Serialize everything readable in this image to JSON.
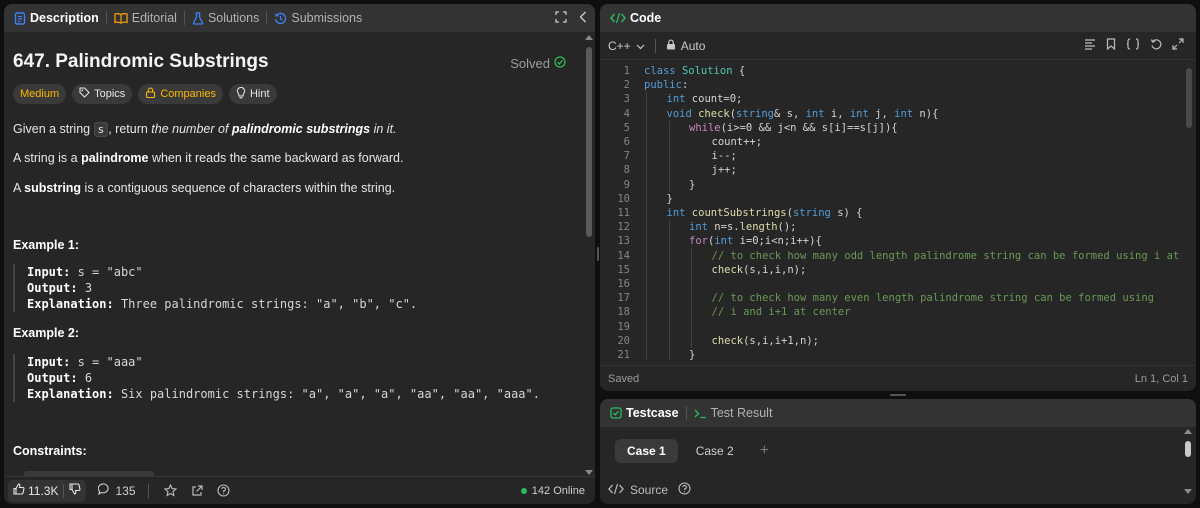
{
  "left_tabs": [
    {
      "label": "Description",
      "icon": "document-icon",
      "color": "#3b82f6"
    },
    {
      "label": "Editorial",
      "icon": "book-icon",
      "color": "#f59e0b"
    },
    {
      "label": "Solutions",
      "icon": "flask-icon",
      "color": "#3b82f6"
    },
    {
      "label": "Submissions",
      "icon": "history-icon",
      "color": "#3b82f6"
    }
  ],
  "problem": {
    "title": "647. Palindromic Substrings",
    "status": "Solved",
    "tags": {
      "difficulty": "Medium",
      "topics": "Topics",
      "companies": "Companies",
      "hint": "Hint"
    },
    "para1": {
      "pre": "Given a string ",
      "code": "s",
      "mid": ", return ",
      "italic_pre": "the number of ",
      "bold_italic": "palindromic substrings",
      "italic_post": " in it."
    },
    "para2": {
      "pre": "A string is a ",
      "bold": "palindrome",
      "post": " when it reads the same backward as forward."
    },
    "para3": {
      "pre": "A ",
      "bold": "substring",
      "post": " is a contiguous sequence of characters within the string."
    },
    "examples": [
      {
        "title": "Example 1:",
        "input_label": "Input:",
        "input": "s = \"abc\"",
        "output_label": "Output:",
        "output": "3",
        "explanation_label": "Explanation:",
        "explanation": "Three palindromic strings: \"a\", \"b\", \"c\"."
      },
      {
        "title": "Example 2:",
        "input_label": "Input:",
        "input": "s = \"aaa\"",
        "output_label": "Output:",
        "output": "6",
        "explanation_label": "Explanation:",
        "explanation": "Six palindromic strings: \"a\", \"a\", \"a\", \"aa\", \"aa\", \"aaa\"."
      }
    ],
    "constraints_title": "Constraints:"
  },
  "left_footer": {
    "likes": "11.3K",
    "comments": "135",
    "online": "142 Online"
  },
  "code_panel": {
    "title": "Code",
    "language": "C++",
    "mode": "Auto",
    "status": "Saved",
    "cursor": "Ln 1, Col 1",
    "lines": [
      {
        "n": "1",
        "indent": 0,
        "parts": [
          [
            "kw",
            "class "
          ],
          [
            "cls",
            "Solution "
          ],
          [
            "",
            "{"
          ]
        ]
      },
      {
        "n": "2",
        "indent": 0,
        "parts": [
          [
            "kw",
            "public"
          ],
          [
            "",
            ":"
          ]
        ]
      },
      {
        "n": "3",
        "indent": 1,
        "parts": [
          [
            "kw",
            "int "
          ],
          [
            "",
            "count=0;"
          ]
        ]
      },
      {
        "n": "4",
        "indent": 1,
        "parts": [
          [
            "kw",
            "void "
          ],
          [
            "fn",
            "check"
          ],
          [
            "",
            "("
          ],
          [
            "kw",
            "string"
          ],
          [
            "",
            "& s, "
          ],
          [
            "kw",
            "int "
          ],
          [
            "",
            "i, "
          ],
          [
            "kw",
            "int "
          ],
          [
            "",
            "j, "
          ],
          [
            "kw",
            "int "
          ],
          [
            "",
            "n){"
          ]
        ]
      },
      {
        "n": "5",
        "indent": 2,
        "parts": [
          [
            "ctl",
            "while"
          ],
          [
            "",
            "(i>=0 && j<n && s[i]==s[j]){"
          ]
        ]
      },
      {
        "n": "6",
        "indent": 3,
        "parts": [
          [
            "",
            "count++;"
          ]
        ]
      },
      {
        "n": "7",
        "indent": 3,
        "parts": [
          [
            "",
            "i--;"
          ]
        ]
      },
      {
        "n": "8",
        "indent": 3,
        "parts": [
          [
            "",
            "j++;"
          ]
        ]
      },
      {
        "n": "9",
        "indent": 2,
        "parts": [
          [
            "",
            "}"
          ]
        ]
      },
      {
        "n": "10",
        "indent": 1,
        "parts": [
          [
            "",
            "}"
          ]
        ]
      },
      {
        "n": "11",
        "indent": 1,
        "parts": [
          [
            "kw",
            "int "
          ],
          [
            "fn",
            "countSubstrings"
          ],
          [
            "",
            "("
          ],
          [
            "kw",
            "string "
          ],
          [
            "",
            "s) {"
          ]
        ]
      },
      {
        "n": "12",
        "indent": 2,
        "parts": [
          [
            "kw",
            "int "
          ],
          [
            "",
            "n=s."
          ],
          [
            "fn",
            "length"
          ],
          [
            "",
            "();"
          ]
        ]
      },
      {
        "n": "13",
        "indent": 2,
        "parts": [
          [
            "ctl",
            "for"
          ],
          [
            "",
            "("
          ],
          [
            "kw",
            "int "
          ],
          [
            "",
            "i=0;i<n;i++){"
          ]
        ]
      },
      {
        "n": "14",
        "indent": 3,
        "parts": [
          [
            "cm",
            "// to check how many odd length palindrome string can be formed using i at center"
          ]
        ]
      },
      {
        "n": "15",
        "indent": 3,
        "parts": [
          [
            "fn",
            "check"
          ],
          [
            "",
            "(s,i,i,n);"
          ]
        ]
      },
      {
        "n": "16",
        "indent": 0,
        "parts": []
      },
      {
        "n": "17",
        "indent": 3,
        "parts": [
          [
            "cm",
            "// to check how many even length palindrome string can be formed using"
          ]
        ]
      },
      {
        "n": "18",
        "indent": 3,
        "parts": [
          [
            "cm",
            "// i and i+1 at center"
          ]
        ]
      },
      {
        "n": "19",
        "indent": 0,
        "parts": []
      },
      {
        "n": "20",
        "indent": 3,
        "parts": [
          [
            "fn",
            "check"
          ],
          [
            "",
            "(s,i,i+1,n);"
          ]
        ]
      },
      {
        "n": "21",
        "indent": 2,
        "parts": [
          [
            "",
            "}"
          ]
        ]
      }
    ]
  },
  "test_panel": {
    "tab_testcase": "Testcase",
    "tab_result": "Test Result",
    "cases": [
      "Case 1",
      "Case 2"
    ],
    "add": "+",
    "source": "Source"
  },
  "colors": {
    "accent_green": "#2cbb5d",
    "medium": "#ffb800",
    "panel_bg": "#262626",
    "tabbar_bg": "#333333"
  }
}
